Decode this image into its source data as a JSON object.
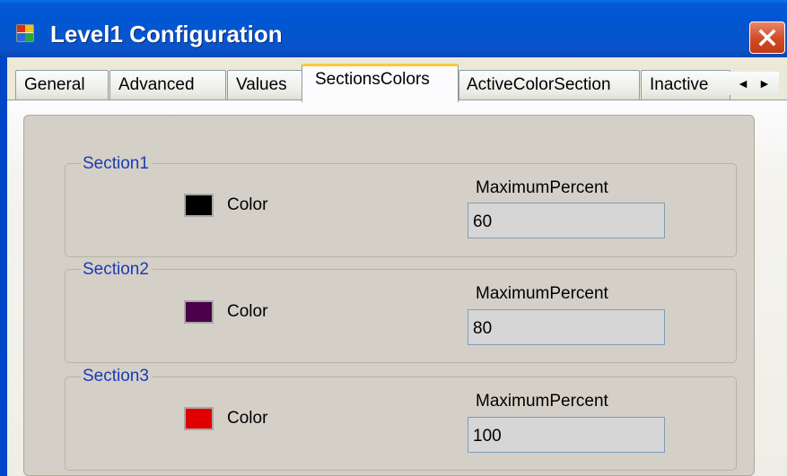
{
  "window": {
    "title": "Level1 Configuration",
    "icon": "form-grid-icon",
    "close_icon": "close-x-icon"
  },
  "tabs": [
    {
      "label": "General",
      "active": false
    },
    {
      "label": "Advanced",
      "active": false
    },
    {
      "label": "Values",
      "active": false
    },
    {
      "label": "SectionsColors",
      "active": true
    },
    {
      "label": "ActiveColorSection",
      "active": false
    },
    {
      "label": "Inactive",
      "active": false
    }
  ],
  "tab_scroll": {
    "left": "◄",
    "right": "►"
  },
  "sections": [
    {
      "title": "Section1",
      "color_label": "Color",
      "color": "#000000",
      "max_label": "MaximumPercent",
      "max_value": "60"
    },
    {
      "title": "Section2",
      "color_label": "Color",
      "color": "#4a004a",
      "max_label": "MaximumPercent",
      "max_value": "80"
    },
    {
      "title": "Section3",
      "color_label": "Color",
      "color": "#e00000",
      "max_label": "MaximumPercent",
      "max_value": "100"
    }
  ]
}
